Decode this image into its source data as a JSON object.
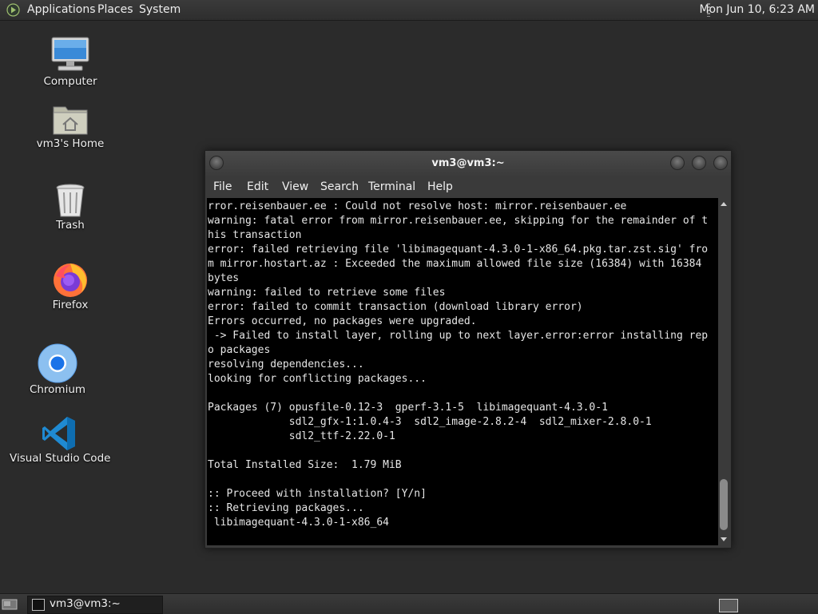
{
  "top_panel": {
    "menus": [
      "Applications",
      "Places",
      "System"
    ],
    "clock": "Mon Jun 10,  6:23 AM"
  },
  "desktop": {
    "icons": [
      {
        "label": "Computer",
        "icon": "computer-icon"
      },
      {
        "label": "vm3's Home",
        "icon": "home-folder-icon"
      },
      {
        "label": "Trash",
        "icon": "trash-icon"
      },
      {
        "label": "Firefox",
        "icon": "firefox-icon"
      },
      {
        "label": "Chromium",
        "icon": "chromium-icon"
      },
      {
        "label": "Visual Studio Code",
        "icon": "vscode-icon"
      }
    ]
  },
  "terminal": {
    "title": "vm3@vm3:~",
    "menus": [
      "File",
      "Edit",
      "View",
      "Search",
      "Terminal",
      "Help"
    ],
    "lines": [
      "rror.reisenbauer.ee : Could not resolve host: mirror.reisenbauer.ee",
      "warning: fatal error from mirror.reisenbauer.ee, skipping for the remainder of t",
      "his transaction",
      "error: failed retrieving file 'libimagequant-4.3.0-1-x86_64.pkg.tar.zst.sig' fro",
      "m mirror.hostart.az : Exceeded the maximum allowed file size (16384) with 16384",
      "bytes",
      "warning: failed to retrieve some files",
      "error: failed to commit transaction (download library error)",
      "Errors occurred, no packages were upgraded.",
      " -> Failed to install layer, rolling up to next layer.error:error installing rep",
      "o packages",
      "resolving dependencies...",
      "looking for conflicting packages...",
      "",
      "Packages (7) opusfile-0.12-3  gperf-3.1-5  libimagequant-4.3.0-1",
      "             sdl2_gfx-1:1.0.4-3  sdl2_image-2.8.2-4  sdl2_mixer-2.8.0-1",
      "             sdl2_ttf-2.22.0-1",
      "",
      "Total Installed Size:  1.79 MiB",
      "",
      ":: Proceed with installation? [Y/n]",
      ":: Retrieving packages...",
      " libimagequant-4.3.0-1-x86_64"
    ]
  },
  "taskbar": {
    "window_label": "vm3@vm3:~"
  }
}
